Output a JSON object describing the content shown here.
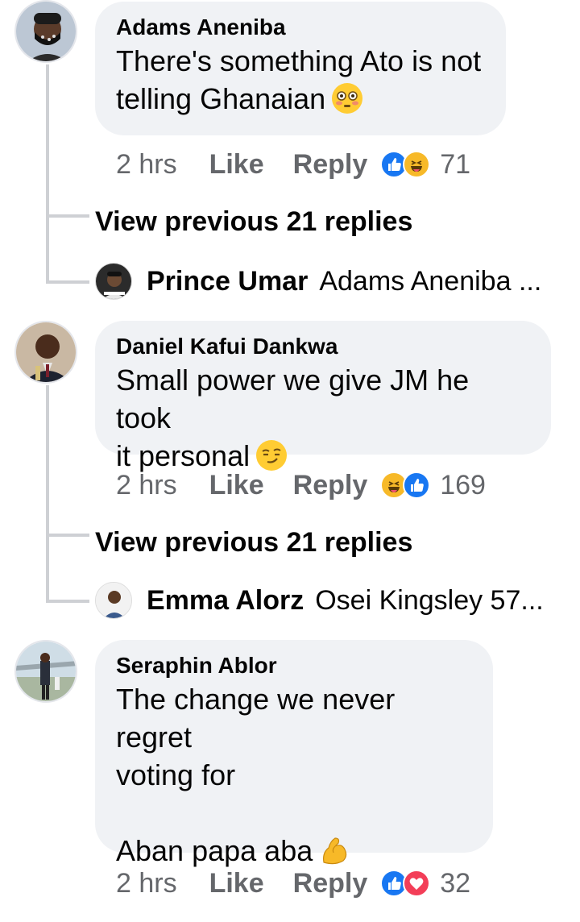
{
  "comments": [
    {
      "author": "Adams Aneniba",
      "line1": "There's something Ato is not",
      "line2": "telling Ghanaian",
      "emoji": "flushed-face-emoji",
      "time": "2 hrs",
      "like": "Like",
      "reply": "Reply",
      "reaction_count": "71",
      "reactions": [
        "like",
        "haha"
      ],
      "view_previous": "View previous 21 replies",
      "reply_preview": {
        "name": "Prince Umar",
        "text": "Adams Aneniba ..."
      }
    },
    {
      "author": "Daniel Kafui Dankwa",
      "line1": "Small power we give JM he took",
      "line2": "it personal",
      "emoji": "smirking-face-emoji",
      "time": "2 hrs",
      "like": "Like",
      "reply": "Reply",
      "reaction_count": "169",
      "reactions": [
        "haha",
        "like"
      ],
      "view_previous": "View previous 21 replies",
      "reply_preview": {
        "name": "Emma Alorz",
        "text": "Osei Kingsley 57..."
      }
    },
    {
      "author": "Seraphin Ablor",
      "line1": "The change we never regret",
      "line2": "voting for",
      "line3": "Aban papa aba",
      "emoji": "flexed-biceps-emoji",
      "time": "2 hrs",
      "like": "Like",
      "reply": "Reply",
      "reaction_count": "32",
      "reactions": [
        "like",
        "love"
      ]
    }
  ],
  "colors": {
    "bubble": "#f0f2f5",
    "meta_gray": "#65676b",
    "thread_line": "#ced0d4",
    "like_blue": "#1877f2",
    "haha_yellow": "#f7b928",
    "love_red": "#f33e58"
  }
}
